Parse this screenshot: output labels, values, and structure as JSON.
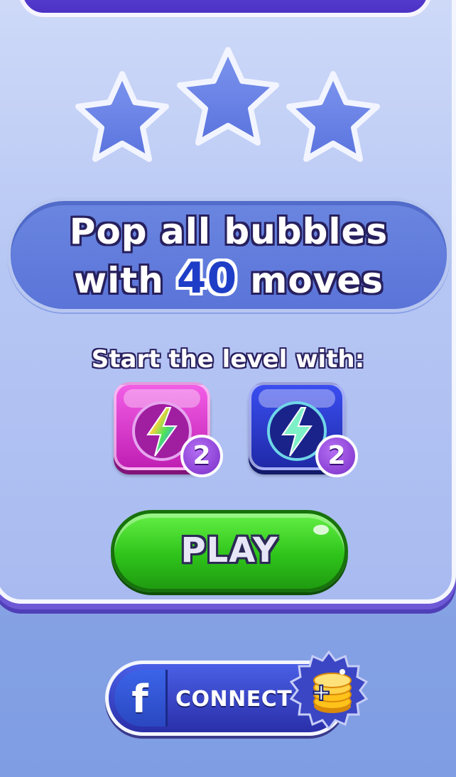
{
  "stars": {
    "earned": 0,
    "total": 3
  },
  "goal": {
    "line1": "Pop all bubbles",
    "with_label": "with",
    "moves_count": "40",
    "moves_label": "moves"
  },
  "boosters": {
    "title": "Start the level with:",
    "items": [
      {
        "name": "rainbow-bolt",
        "count": "2",
        "color": "#d335c8"
      },
      {
        "name": "lightning-bolt",
        "count": "2",
        "color": "#2a37c8"
      }
    ]
  },
  "play_button": {
    "label": "PLAY",
    "color": "#3fd42a"
  },
  "connect_button": {
    "fb_letter": "f",
    "label": "CONNECT",
    "coin_plus": "+"
  }
}
